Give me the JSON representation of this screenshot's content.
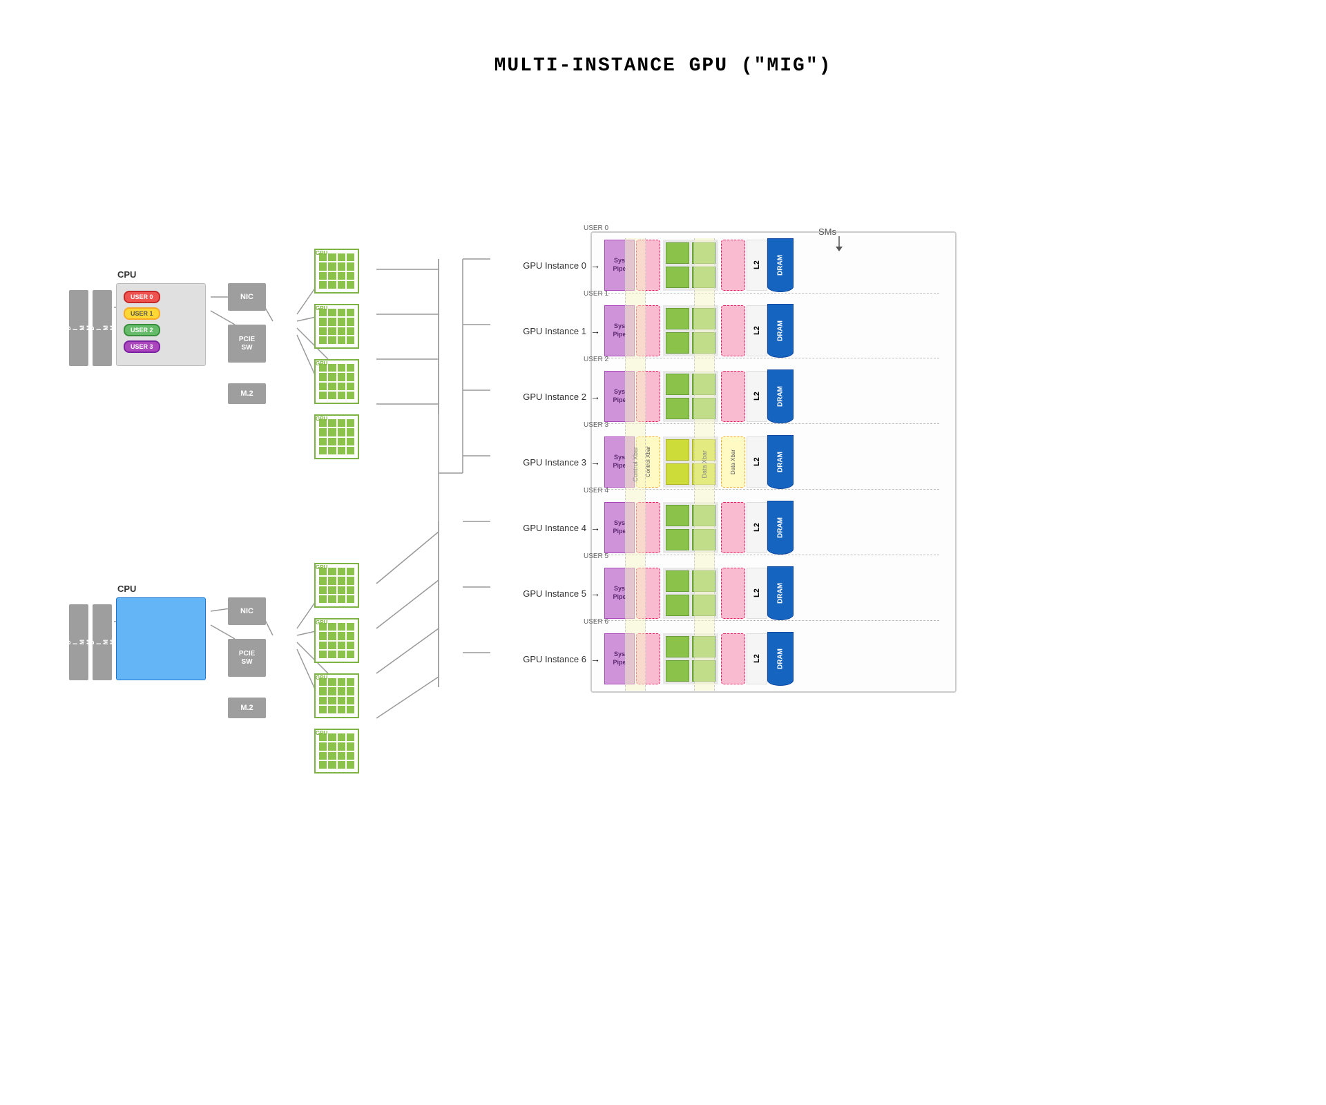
{
  "title": "MULTI-INSTANCE GPU (\"MIG\")",
  "colors": {
    "green_border": "#7cb342",
    "green_fill": "#8bc34a",
    "gray": "#9e9e9e",
    "blue_cpu": "#64b5f6",
    "purple": "#ce93d8",
    "pink_bg": "#f8bbd0",
    "yellow_bg": "#fff9c4",
    "orange_l2": "#f9a825",
    "blue_dram": "#1565c0",
    "user0_bg": "#ef9a9a",
    "user1_bg": "#fff176",
    "user2_bg": "#a5d6a7",
    "user3_bg": "#ce93d8"
  },
  "systems": [
    {
      "id": "top",
      "users": [
        "USER 0",
        "USER 1",
        "USER 2",
        "USER 3"
      ],
      "user_colors": [
        "#ef5350",
        "#fdd835",
        "#66bb6a",
        "#ab47bc"
      ],
      "has_users": true
    },
    {
      "id": "bottom",
      "has_users": false
    }
  ],
  "gpu_instances": [
    {
      "id": 0,
      "label": "GPU Instance 0",
      "user": "USER 0",
      "sm_color": "#8bc34a"
    },
    {
      "id": 1,
      "label": "GPU Instance 1",
      "user": "USER 1",
      "sm_color": "#8bc34a"
    },
    {
      "id": 2,
      "label": "GPU Instance 2",
      "user": "USER 2",
      "sm_color": "#8bc34a"
    },
    {
      "id": 3,
      "label": "GPU Instance 3",
      "user": "USER 3",
      "sm_color": "#cddc39"
    },
    {
      "id": 4,
      "label": "GPU Instance 4",
      "user": "USER 4",
      "sm_color": "#8bc34a"
    },
    {
      "id": 5,
      "label": "GPU Instance 5",
      "user": "USER 5",
      "sm_color": "#8bc34a"
    },
    {
      "id": 6,
      "label": "GPU Instance 6",
      "user": "USER 6",
      "sm_color": "#8bc34a"
    }
  ],
  "labels": {
    "sms": "SMs",
    "sys_pipe": "Sys\nPipe",
    "control_xbar": "Control Xbar",
    "data_xbar": "Data Xbar",
    "l2": "L2",
    "dram": "DRAM",
    "nic": "NIC",
    "pcie_sw": "PCIE\nSW",
    "m2": "M.2",
    "cpu": "CPU",
    "dimm": "D\nI\nM\nM"
  }
}
